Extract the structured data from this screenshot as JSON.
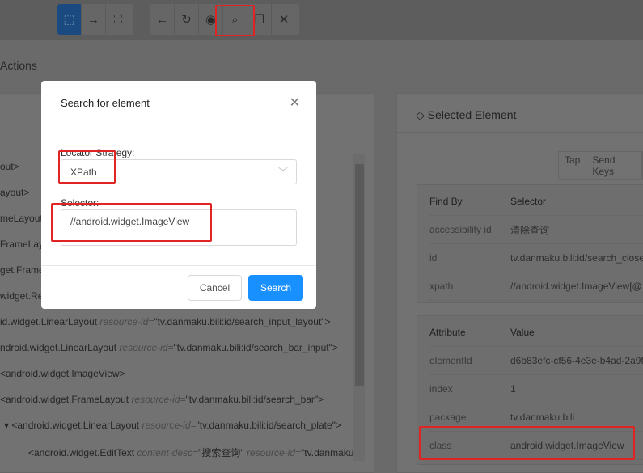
{
  "toolbar": {
    "group1": [
      {
        "icon": "select-element-icon"
      },
      {
        "icon": "swipe-arrow-icon"
      },
      {
        "icon": "tap-coordinates-icon"
      }
    ],
    "group2": [
      {
        "icon": "back-icon",
        "glyph": "←"
      },
      {
        "icon": "refresh-icon",
        "glyph": "↻"
      },
      {
        "icon": "eye-icon",
        "glyph": "◉"
      },
      {
        "icon": "search-icon",
        "glyph": "⌕"
      },
      {
        "icon": "copy-icon",
        "glyph": "❐"
      },
      {
        "icon": "close-icon",
        "glyph": "✕"
      }
    ]
  },
  "left": {
    "tab": "Actions",
    "tree": [
      {
        "t": "out>"
      },
      {
        "t": "ayout>"
      },
      {
        "t": "meLayout"
      },
      {
        "t": "FrameLay"
      },
      {
        "t": "get.Frame"
      },
      {
        "t": "widget.Rel"
      },
      {
        "t": "id.widget.LinearLayout ",
        "a": "resource-id=",
        "v": "\"tv.danmaku.bili:id/search_input_layout\">"
      },
      {
        "t": "ndroid.widget.LinearLayout ",
        "a": "resource-id=",
        "v": "\"tv.danmaku.bili:id/search_bar_input\">"
      },
      {
        "t": "<android.widget.ImageView>"
      },
      {
        "t": "<android.widget.FrameLayout ",
        "a": "resource-id=",
        "v": "\"tv.danmaku.bili:id/search_bar\">"
      },
      {
        "t": "▾   <android.widget.LinearLayout ",
        "a": "resource-id=",
        "v": "\"tv.danmaku.bili:id/search_plate\">"
      },
      {
        "t": "<android.widget.EditText ",
        "a": "content-desc=",
        "v": "\"搜索查询\" ",
        "a2": "resource-id=",
        "v2": "\"tv.danmaku"
      }
    ]
  },
  "right": {
    "title": "Selected Element",
    "actions": [
      "Tap",
      "Send Keys"
    ],
    "findby": {
      "headers": [
        "Find By",
        "Selector"
      ],
      "rows": [
        [
          "accessibility id",
          "清除查询"
        ],
        [
          "id",
          "tv.danmaku.bili:id/search_close_"
        ],
        [
          "xpath",
          "//android.widget.ImageView[@"
        ]
      ]
    },
    "attrs": {
      "headers": [
        "Attribute",
        "Value"
      ],
      "rows": [
        [
          "elementId",
          "d6b83efc-cf56-4e3e-b4ad-2a9f"
        ],
        [
          "index",
          "1"
        ],
        [
          "package",
          "tv.danmaku.bili"
        ],
        [
          "class",
          "android.widget.ImageView"
        ]
      ]
    }
  },
  "modal": {
    "title": "Search for element",
    "strategy_label": "Locator Strategy:",
    "strategy_value": "XPath",
    "selector_label": "Selector:",
    "selector_value": "//android.widget.ImageView",
    "cancel": "Cancel",
    "search": "Search"
  }
}
